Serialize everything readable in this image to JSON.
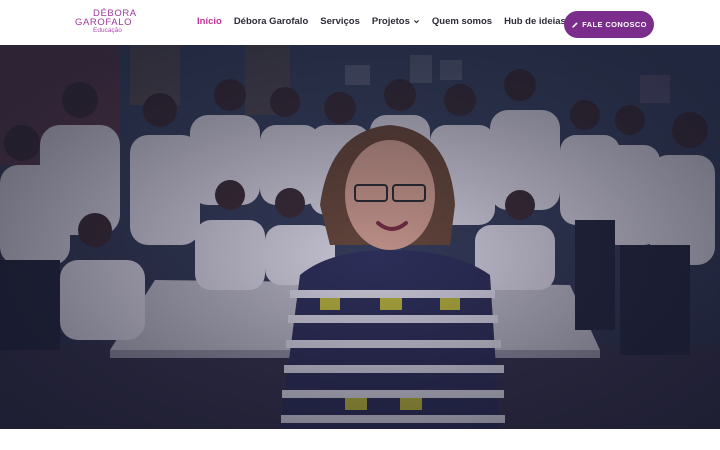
{
  "logo": {
    "line1": "DÉBORA",
    "line2": "GAROFALO",
    "line3": "Educação"
  },
  "nav": {
    "items": [
      {
        "label": "Início",
        "active": true
      },
      {
        "label": "Débora Garofalo",
        "active": false
      },
      {
        "label": "Serviços",
        "active": false
      },
      {
        "label": "Projetos",
        "active": false,
        "has_dropdown": true
      },
      {
        "label": "Quem somos",
        "active": false
      },
      {
        "label": "Hub de ideias",
        "active": false,
        "has_dropdown": true
      }
    ]
  },
  "cta": {
    "label": "FALE CONOSCO",
    "icon": "pencil-icon"
  },
  "hero": {
    "image": "classroom-group-photo"
  },
  "colors": {
    "brand_purple": "#7a2d8a",
    "active_link": "#c0349a",
    "nav_text": "#2c2c3a"
  }
}
